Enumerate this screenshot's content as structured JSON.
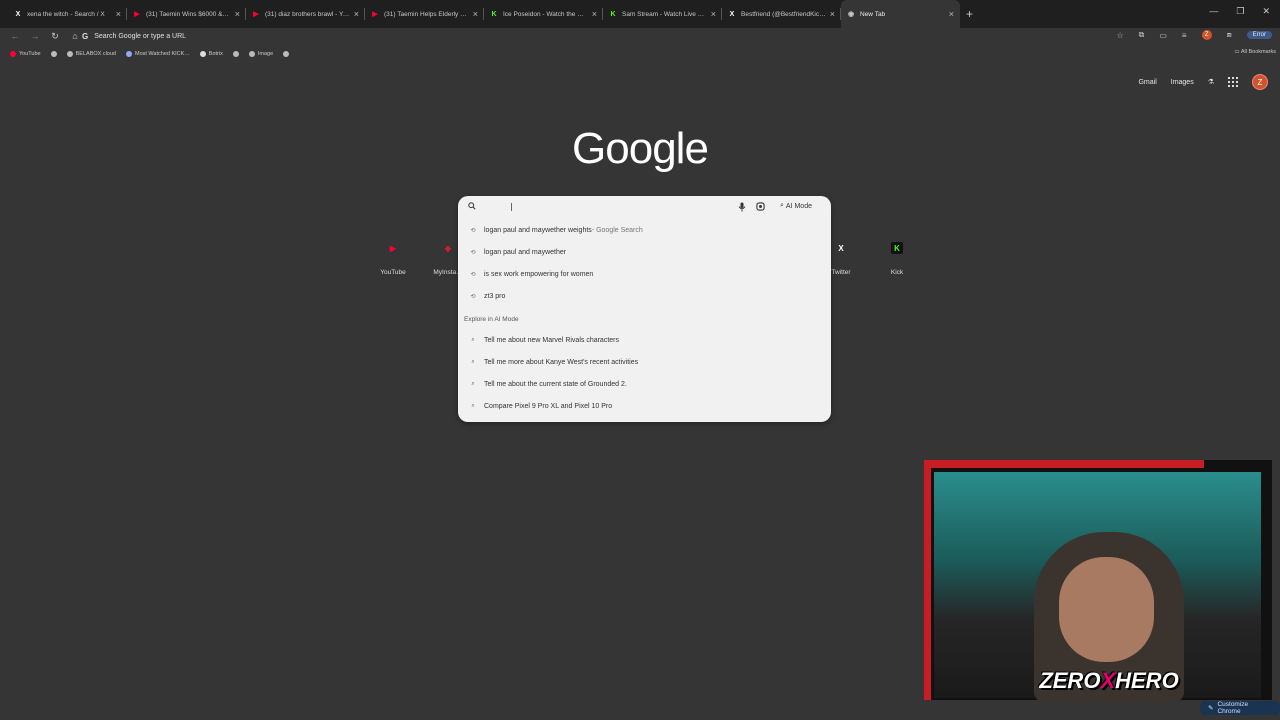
{
  "browser": {
    "tabs": [
      {
        "title": "xena the witch - Search / X",
        "icon": "x-logo-icon",
        "color": "#ffffff"
      },
      {
        "title": "(31) Taemin Wins $6000 & Mo…",
        "icon": "youtube-icon",
        "color": "#ff0033"
      },
      {
        "title": "(31) diaz brothers brawl - YouT…",
        "icon": "youtube-icon",
        "color": "#ff0033"
      },
      {
        "title": "(31) Taemin Helps Elderly Lady…",
        "icon": "youtube-icon",
        "color": "#ff0033"
      },
      {
        "title": "Ice Poseidon - Watch the VOD…",
        "icon": "kick-icon",
        "color": "#53fc18"
      },
      {
        "title": "Sam Stream - Watch Live on Ki…",
        "icon": "kick-icon",
        "color": "#53fc18"
      },
      {
        "title": "Bestfriend (@BestfriendKick) /…",
        "icon": "x-logo-icon",
        "color": "#ffffff"
      },
      {
        "title": "New Tab",
        "icon": "chrome-icon",
        "color": "#cccccc",
        "active": true
      }
    ],
    "new_tab_symbol": "+",
    "omnibox_placeholder": "Search Google or type a URL",
    "error_badge": "Error",
    "profile_initial": "Z",
    "bookmarks": [
      {
        "label": "YouTube",
        "icon": "youtube-icon",
        "color": "#ff0033"
      },
      {
        "label": "",
        "icon": "globe-icon",
        "color": "#bbbbbb"
      },
      {
        "label": "BELABOX cloud",
        "icon": "globe-icon",
        "color": "#bbbbbb"
      },
      {
        "label": "Most Watched KICK…",
        "icon": "globe-icon",
        "color": "#8fa8ff"
      },
      {
        "label": "Botrix",
        "icon": "diamond-icon",
        "color": "#dddddd"
      },
      {
        "label": "",
        "icon": "globe-icon",
        "color": "#bbbbbb"
      },
      {
        "label": "Image",
        "icon": "globe-icon",
        "color": "#bbbbbb"
      },
      {
        "label": "",
        "icon": "globe-icon",
        "color": "#bbbbbb"
      }
    ],
    "all_bookmarks": "All Bookmarks"
  },
  "page": {
    "top_links": {
      "gmail": "Gmail",
      "images": "Images"
    },
    "avatar_initial": "Z",
    "logo": "Google",
    "shortcuts": [
      {
        "label": "YouTube",
        "icon": "youtube-icon",
        "color": "#ff0033",
        "glyph": "▶"
      },
      {
        "label": "MyInsta…",
        "icon": "app-icon",
        "color": "#d01f2a",
        "glyph": "◆"
      },
      {
        "label": "Twitter",
        "icon": "x-logo-icon",
        "color": "#ffffff",
        "glyph": "X"
      },
      {
        "label": "Kick",
        "icon": "kick-icon",
        "color": "#53fc18",
        "glyph": "K"
      }
    ],
    "search": {
      "ai_mode_label": "AI Mode",
      "history": [
        {
          "text": "logan paul and maywether weights",
          "suffix": " - Google Search"
        },
        {
          "text": "logan paul and maywether",
          "suffix": ""
        },
        {
          "text": "is sex work empowering for women",
          "suffix": ""
        },
        {
          "text": "zt3 pro",
          "suffix": ""
        }
      ],
      "ai_section_title": "Explore in AI Mode",
      "ai_suggestions": [
        "Tell me about new Marvel Rivals characters",
        "Tell me more about Kanye West's recent activities",
        "Tell me about the current state of Grounded 2.",
        "Compare Pixel 9 Pro XL and Pixel 10 Pro"
      ]
    },
    "customize_chrome": "Customize Chrome"
  },
  "overlay": {
    "brand_left": "ZERO",
    "brand_x": "X",
    "brand_right": "HERO"
  }
}
